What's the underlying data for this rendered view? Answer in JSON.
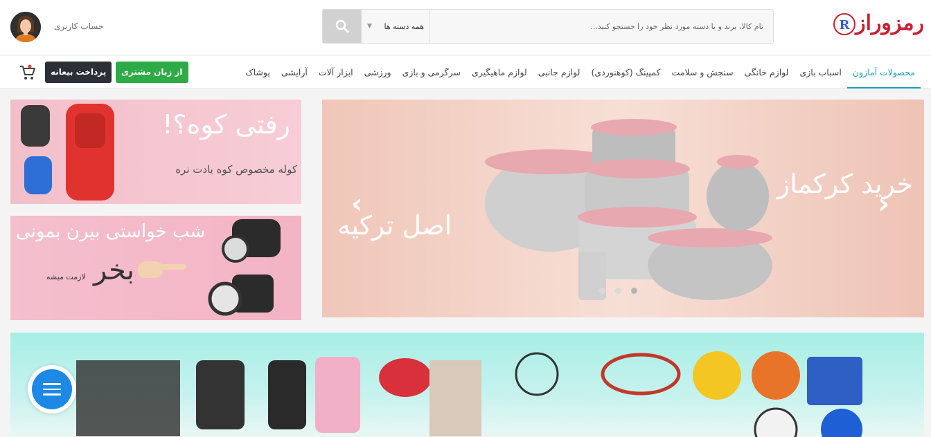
{
  "header": {
    "logo_text": "رمزوراز",
    "search": {
      "placeholder": "نام کالا، برند و یا دسته مورد نظر خود را جستجو کنید...",
      "category": "همه دسته ها",
      "button_icon": "search-icon"
    },
    "account_label": "حساب کاربری",
    "avatar_icon": "user-avatar-icon"
  },
  "nav": {
    "items": [
      {
        "label": "محصولات آمازون",
        "active": true
      },
      {
        "label": "اسباب بازی"
      },
      {
        "label": "لوازم خانگی"
      },
      {
        "label": "سنجش و سلامت"
      },
      {
        "label": "کمپینگ (کوهنوردی)"
      },
      {
        "label": "لوازم جانبی"
      },
      {
        "label": "لوازم ماهیگیری"
      },
      {
        "label": "سرگرمی و بازی"
      },
      {
        "label": "ورزشی"
      },
      {
        "label": "ابزار آلات"
      },
      {
        "label": "آرایشی"
      },
      {
        "label": "پوشاک"
      }
    ],
    "customer_button": "از زبان مشتری",
    "prepay_button": "پرداخت بیعانه",
    "cart_icon": "cart-icon"
  },
  "slider": {
    "title": "خرید کرکماز",
    "subtitle": "اصل ترکیه",
    "dots": 3,
    "active_dot": 3
  },
  "banner_mountain": {
    "title": "رفتی کوه؟!",
    "subtitle": "کوله مخصوص کوه یادت نره"
  },
  "banner_night": {
    "title": "شب خواستی بیرن بمونی",
    "big": "بخر",
    "small": "لازمت میشه"
  },
  "colors": {
    "accent": "#1a9ec0",
    "green_button": "#2eaa46",
    "dark_button": "#2b2f36",
    "chat": "#1e88e5"
  }
}
